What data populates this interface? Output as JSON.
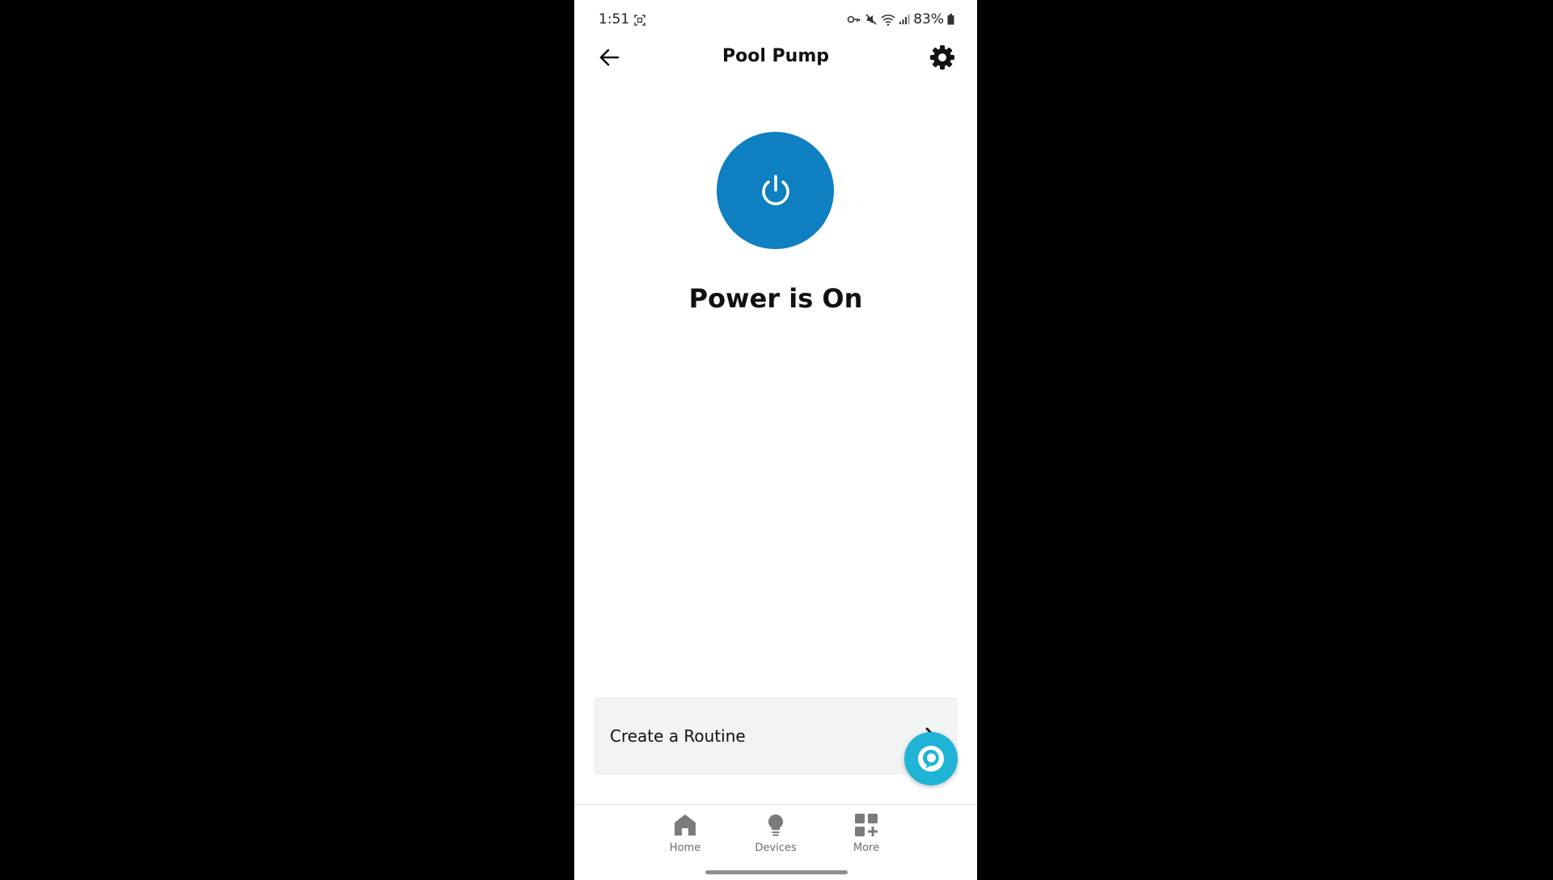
{
  "status_bar": {
    "time": "1:51",
    "battery": "83%",
    "icons": [
      "screenshot-icon",
      "key-icon",
      "mute-icon",
      "wifi-icon",
      "signal-icon",
      "battery-icon"
    ]
  },
  "header": {
    "title": "Pool Pump",
    "back_icon": "arrow-left-icon",
    "settings_icon": "gear-icon"
  },
  "device": {
    "power_icon": "power-icon",
    "power_color": "#0e7fc0",
    "status": "Power is On"
  },
  "routine": {
    "label": "Create a Routine",
    "chevron_icon": "chevron-right-icon"
  },
  "alexa_fab": {
    "icon": "alexa-icon",
    "color": "#1fb4d6"
  },
  "bottom_nav": {
    "items": [
      {
        "label": "Home",
        "icon": "home-icon"
      },
      {
        "label": "Devices",
        "icon": "lightbulb-icon"
      },
      {
        "label": "More",
        "icon": "more-grid-icon"
      }
    ]
  }
}
